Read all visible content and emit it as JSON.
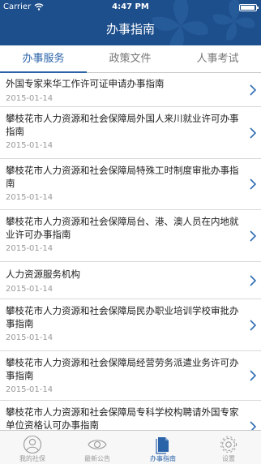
{
  "status_bar": {
    "carrier": "Carrier",
    "time": "4:47 PM",
    "battery_level": 0.95
  },
  "header": {
    "title": "办事指南"
  },
  "tabs": [
    {
      "label": "办事服务",
      "active": true
    },
    {
      "label": "政策文件",
      "active": false
    },
    {
      "label": "人事考试",
      "active": false
    }
  ],
  "items": [
    {
      "title": "外国专家来华工作许可证申请办事指南",
      "date": "2015-01-14"
    },
    {
      "title": "攀枝花市人力资源和社会保障局外国人来川就业许可办事指南",
      "date": "2015-01-14"
    },
    {
      "title": "攀枝花市人力资源和社会保障局特殊工时制度审批办事指南",
      "date": "2015-01-14"
    },
    {
      "title": "攀枝花市人力资源和社会保障局台、港、澳人员在内地就业许可办事指南",
      "date": "2015-01-14"
    },
    {
      "title": "人力资源服务机构",
      "date": "2015-01-14"
    },
    {
      "title": "攀枝花市人力资源和社会保障局民办职业培训学校审批办事指南",
      "date": "2015-01-14"
    },
    {
      "title": "攀枝花市人力资源和社会保障局经营劳务派遣业务许可办事指南",
      "date": "2015-01-14"
    },
    {
      "title": "攀枝花市人力资源和社会保障局专科学校构聘请外国专家单位资格认可办事指南",
      "date": ""
    }
  ],
  "tabbar": [
    {
      "label": "我的社保",
      "icon": "person-icon",
      "active": false
    },
    {
      "label": "最新公告",
      "icon": "eye-icon",
      "active": false
    },
    {
      "label": "办事指南",
      "icon": "document-icon",
      "active": true
    },
    {
      "label": "设置",
      "icon": "gear-icon",
      "active": false
    }
  ],
  "colors": {
    "header": "#1d4f8c",
    "accent": "#2a63a8",
    "chevron": "#2f6db4"
  }
}
